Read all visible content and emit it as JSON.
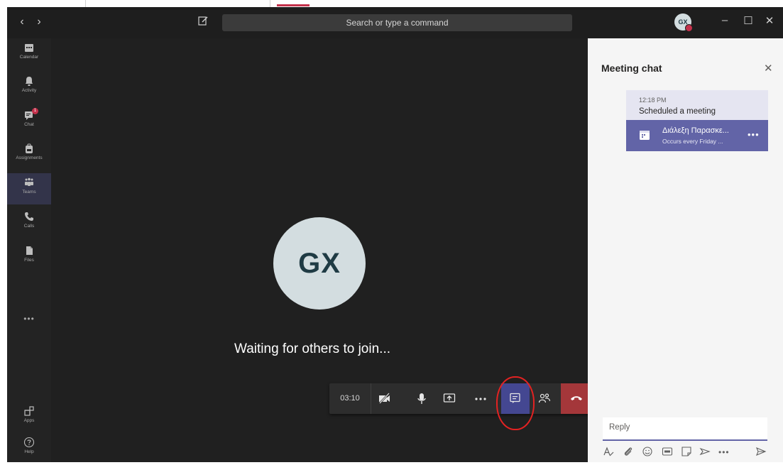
{
  "window": {
    "search_placeholder": "Search or type a command",
    "user_initials": "GX"
  },
  "rail": {
    "items": [
      {
        "label": "Calendar"
      },
      {
        "label": "Activity"
      },
      {
        "label": "Chat",
        "badge": "1"
      },
      {
        "label": "Assignments"
      },
      {
        "label": "Teams",
        "active": true
      },
      {
        "label": "Calls"
      },
      {
        "label": "Files"
      }
    ],
    "bottom": [
      {
        "label": "Apps"
      },
      {
        "label": "Help"
      }
    ]
  },
  "stage": {
    "avatar_initials": "GX",
    "status_text": "Waiting for others to join...",
    "call_timer": "03:10"
  },
  "chat": {
    "title": "Meeting chat",
    "message": {
      "time": "12:18 PM",
      "text": "Scheduled a meeting"
    },
    "card": {
      "title": "Διάλεξη Παρασκε...",
      "subtitle": "Occurs every Friday ..."
    },
    "reply_placeholder": "Reply"
  },
  "colors": {
    "accent": "#6264a7",
    "hangup": "#a4373a",
    "badge": "#c4314b"
  }
}
